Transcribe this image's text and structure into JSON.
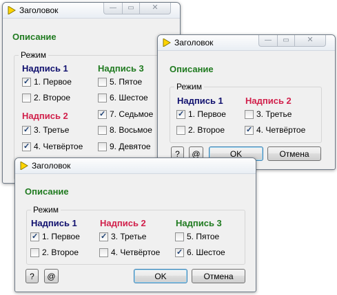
{
  "title": "Заголовок",
  "description": "Описание",
  "group_label": "Режим",
  "icons": {
    "app": "yellow-play-triangle-icon"
  },
  "controls": {
    "minimize": "—",
    "maximize": "▭",
    "close": "✕"
  },
  "buttons": {
    "help": "?",
    "at": "@",
    "ok": "OK",
    "cancel": "Отмена"
  },
  "colors": {
    "description": "#1f7a1f",
    "caption_1": "#10106e",
    "caption_2": "#d1204b",
    "caption_3": "#1f7a1f"
  },
  "win1": {
    "captions": {
      "c1": "Надпись 1",
      "c2": "Надпись 2",
      "c3": "Надпись 3"
    },
    "items": [
      {
        "label": "1. Первое",
        "checked": true
      },
      {
        "label": "2. Второе",
        "checked": false
      },
      {
        "label": "3. Третье",
        "checked": true
      },
      {
        "label": "4. Четвёртое",
        "checked": true
      },
      {
        "label": "5. Пятое",
        "checked": false
      },
      {
        "label": "6. Шестое",
        "checked": false
      },
      {
        "label": "7. Седьмое",
        "checked": true
      },
      {
        "label": "8. Восьмое",
        "checked": false
      },
      {
        "label": "9. Девятое",
        "checked": false
      }
    ]
  },
  "win2": {
    "captions": {
      "c1": "Надпись 1",
      "c2": "Надпись 2"
    },
    "items": [
      {
        "label": "1. Первое",
        "checked": true
      },
      {
        "label": "2. Второе",
        "checked": false
      },
      {
        "label": "3. Третье",
        "checked": false
      },
      {
        "label": "4. Четвёртое",
        "checked": true
      }
    ]
  },
  "win3": {
    "captions": {
      "c1": "Надпись 1",
      "c2": "Надпись 2",
      "c3": "Надпись 3"
    },
    "items": [
      {
        "label": "1. Первое",
        "checked": true
      },
      {
        "label": "2. Второе",
        "checked": false
      },
      {
        "label": "3. Третье",
        "checked": true
      },
      {
        "label": "4. Четвёртое",
        "checked": false
      },
      {
        "label": "5. Пятое",
        "checked": false
      },
      {
        "label": "6. Шестое",
        "checked": true
      }
    ]
  }
}
